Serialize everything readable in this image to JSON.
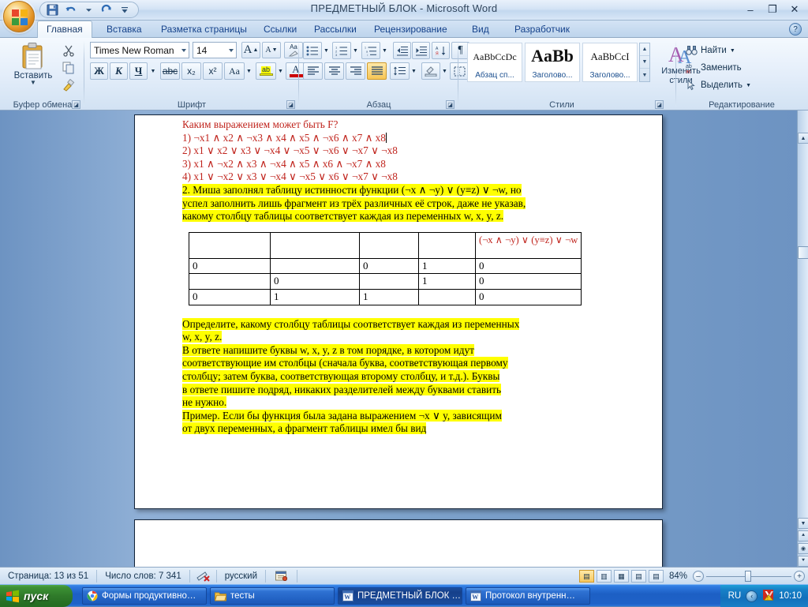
{
  "window": {
    "title": "ПРЕДМЕТНЫЙ БЛОК  -  Microsoft Word",
    "minimize": "–",
    "maximize": "❐",
    "close": "✕"
  },
  "quick_access": {
    "save": "save-icon",
    "undo": "undo-icon",
    "redo": "redo-icon",
    "customize": "customize-icon"
  },
  "ribbon": {
    "help": "?",
    "tabs": [
      {
        "label": "Главная",
        "active": true
      },
      {
        "label": "Вставка",
        "active": false
      },
      {
        "label": "Разметка страницы",
        "active": false
      },
      {
        "label": "Ссылки",
        "active": false
      },
      {
        "label": "Рассылки",
        "active": false
      },
      {
        "label": "Рецензирование",
        "active": false
      },
      {
        "label": "Вид",
        "active": false
      },
      {
        "label": "Разработчик",
        "active": false
      }
    ],
    "clipboard": {
      "group_label": "Буфер обмена",
      "paste_label": "Вставить",
      "paste_arrow": "▼",
      "cut": "scissors-icon",
      "copy": "copy-icon",
      "format_painter": "format-painter-icon"
    },
    "font": {
      "group_label": "Шрифт",
      "font_name": "Times New Roman",
      "font_size": "14",
      "grow_font": "A",
      "shrink_font": "A",
      "clear_formatting": "Aa",
      "bold": "Ж",
      "italic": "К",
      "underline": "Ч",
      "strikethrough": "abc",
      "subscript": "x₂",
      "superscript": "x²",
      "change_case": "Aa",
      "highlight": "ab",
      "font_color": "A"
    },
    "paragraph": {
      "group_label": "Абзац",
      "bullets": "bullet-list-icon",
      "numbering": "numbered-list-icon",
      "multilevel": "multilevel-list-icon",
      "decrease_indent": "decrease-indent-icon",
      "increase_indent": "increase-indent-icon",
      "sort": "sort-icon",
      "show_marks": "¶",
      "align_left": "align-left-icon",
      "align_center": "align-center-icon",
      "align_right": "align-right-icon",
      "align_justify": "align-justify-icon",
      "line_spacing": "line-spacing-icon",
      "shading": "shading-icon",
      "borders": "borders-icon"
    },
    "styles": {
      "group_label": "Стили",
      "items": [
        {
          "sample": "AaBbCcDc",
          "name": "Абзац сп...",
          "size": "12px",
          "weight": "normal"
        },
        {
          "sample": "AaBb",
          "name": "Заголово...",
          "size": "22px",
          "weight": "bold"
        },
        {
          "sample": "AaBbCcI",
          "name": "Заголово...",
          "size": "13px",
          "weight": "normal"
        }
      ],
      "change_styles": "Изменить стили"
    },
    "editing": {
      "group_label": "Редактирование",
      "find": "Найти",
      "replace": "Заменить",
      "select": "Выделить"
    }
  },
  "document": {
    "red_lines": [
      "Каким выражением может быть F?",
      "1) ¬x1 ∧ x2 ∧ ¬x3 ∧ x4 ∧ x5 ∧ ¬x6 ∧ x7 ∧ x8",
      "2) x1 ∨ x2 ∨ x3 ∨ ¬x4 ∨ ¬x5 ∨ ¬x6 ∨ ¬x7 ∨ ¬x8",
      "3) x1 ∧ ¬x2 ∧ x3 ∧ ¬x4 ∧ x5 ∧ x6 ∧ ¬x7 ∧ x8",
      "4) x1 ∨ ¬x2 ∨ x3 ∨ ¬x4 ∨ ¬x5 ∨ x6 ∨ ¬x7 ∨ ¬x8"
    ],
    "task2_lines": [
      "2. Миша заполнял таблицу истинности функции (¬x ∧ ¬y) ∨ (y≡z) ∨ ¬w, но",
      "успел заполнить лишь фрагмент из трёх различных её строк, даже не указав,",
      "какому столбцу таблицы соответствует каждая из переменных w, x, y, z."
    ],
    "table": {
      "header": [
        "",
        "",
        "",
        "",
        "(¬x ∧ ¬y) ∨ (y≡z) ∨ ¬w"
      ],
      "rows": [
        [
          "0",
          "",
          "0",
          "1",
          "0"
        ],
        [
          "",
          "0",
          "",
          "1",
          "0"
        ],
        [
          "0",
          "1",
          "1",
          "",
          "0"
        ]
      ]
    },
    "bottom_lines": [
      "Определите, какому столбцу таблицы соответствует каждая из переменных",
      "w, x, y, z.",
      "В ответе напишите буквы w, x, y, z в том порядке, в котором идут",
      "соответствующие им столбцы (сначала буква, соответствующая первому",
      "столбцу; затем буква, соответствующая второму столбцу, и т.д.). Буквы",
      "в ответе пишите подряд, никаких разделителей между буквами ставить",
      "не нужно.",
      "Пример. Если бы функция была задана выражением ¬x ∨ y, зависящим",
      "от двух переменных, а фрагмент таблицы имел бы вид"
    ]
  },
  "status_bar": {
    "page": "Страница: 13 из 51",
    "words": "Число слов: 7 341",
    "proofing_icon": "proofing-error-icon",
    "language": "русский",
    "macro_icon": "macro-record-icon",
    "views": [
      {
        "name": "print-layout-view",
        "glyph": "▤",
        "active": true
      },
      {
        "name": "full-screen-reading-view",
        "glyph": "▥",
        "active": false
      },
      {
        "name": "web-layout-view",
        "glyph": "▦",
        "active": false
      },
      {
        "name": "outline-view",
        "glyph": "▤",
        "active": false
      },
      {
        "name": "draft-view",
        "glyph": "▤",
        "active": false
      }
    ],
    "zoom": "84%",
    "zoom_out": "–",
    "zoom_in": "+"
  },
  "taskbar": {
    "start": "пуск",
    "items": [
      {
        "label": "Формы продуктивно…",
        "icon": "chrome-icon",
        "active": false
      },
      {
        "label": "тесты",
        "icon": "folder-icon",
        "active": false
      },
      {
        "label": "ПРЕДМЕТНЫЙ БЛОК …",
        "icon": "word-icon",
        "active": true
      },
      {
        "label": "Протокол внутренн…",
        "icon": "word-icon",
        "active": false
      }
    ],
    "tray": {
      "language": "RU",
      "show_hidden": "‹",
      "antivirus": "antivirus-icon",
      "clock": "10:10"
    }
  },
  "colors": {
    "red_text": "#c0241d",
    "highlight": "#ffff00",
    "accent": "#15428b"
  }
}
